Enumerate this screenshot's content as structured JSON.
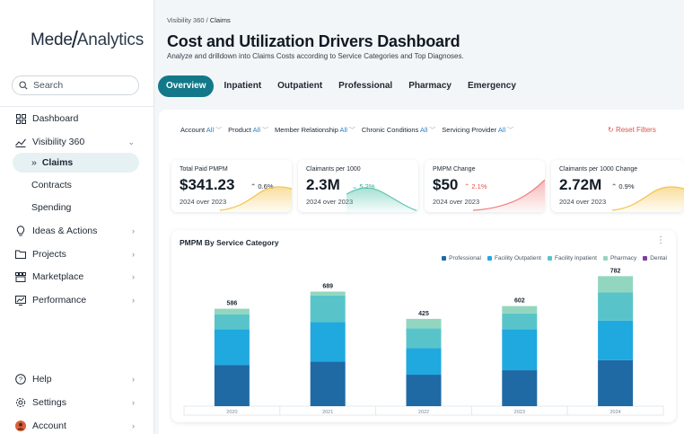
{
  "sidebar": {
    "logo_left": "Mede",
    "logo_slash": "/",
    "logo_right": "Analytics",
    "search_placeholder": "Search",
    "items": [
      {
        "label": "Dashboard",
        "icon": "grid-icon"
      },
      {
        "label": "Visibility 360",
        "icon": "trend-icon"
      },
      {
        "label": "Claims",
        "icon": "double-chevron-icon"
      },
      {
        "label": "Contracts"
      },
      {
        "label": "Spending"
      },
      {
        "label": "Ideas & Actions",
        "icon": "lightbulb-icon"
      },
      {
        "label": "Projects",
        "icon": "folder-icon"
      },
      {
        "label": "Marketplace",
        "icon": "store-icon"
      },
      {
        "label": "Performance",
        "icon": "chart-icon"
      }
    ],
    "bottom": [
      {
        "label": "Help",
        "icon": "help-icon"
      },
      {
        "label": "Settings",
        "icon": "gear-icon"
      },
      {
        "label": "Account",
        "icon": "avatar-icon"
      }
    ]
  },
  "header": {
    "breadcrumb_section": "Visibility 360",
    "breadcrumb_sep": " / ",
    "breadcrumb_page": "Claims",
    "title": "Cost and Utilization Drivers Dashboard",
    "subtitle": "Analyze and drilldown into Claims Costs according to Service Categories and Top Diagnoses."
  },
  "tabs": [
    "Overview",
    "Inpatient",
    "Outpatient",
    "Professional",
    "Pharmacy",
    "Emergency"
  ],
  "filters": [
    {
      "label": "Account",
      "value": "All"
    },
    {
      "label": "Product",
      "value": "All"
    },
    {
      "label": "Member Relationship",
      "value": "All"
    },
    {
      "label": "Chronic Conditions",
      "value": "All"
    },
    {
      "label": "Servicing Provider",
      "value": "All"
    }
  ],
  "reset_label": "Reset Filters",
  "kpis": [
    {
      "label": "Total Paid PMPM",
      "value": "$341.23",
      "delta": "0.6%",
      "direction": "up",
      "delta_color": "#1d2733",
      "sub": "2024 over 2023",
      "spark_color": "#f3c24a"
    },
    {
      "label": "Claimants per 1000",
      "value": "2.3M",
      "delta": "5.2%",
      "direction": "down",
      "delta_color": "#3aa58f",
      "sub": "2024 over 2023",
      "spark_color": "#5cc6b1"
    },
    {
      "label": "PMPM Change",
      "value": "$50",
      "delta": "2.1%",
      "direction": "up",
      "delta_color": "#e0524a",
      "sub": "2024 over 2023",
      "spark_color": "#ef7c7c"
    },
    {
      "label": "Claimants per 1000 Change",
      "value": "2.72M",
      "delta": "0.9%",
      "direction": "up",
      "delta_color": "#1d2733",
      "sub": "2024 over 2023",
      "spark_color": "#f3c24a"
    }
  ],
  "chart_title": "PMPM By Service Category",
  "chart_data": {
    "type": "bar",
    "stacked": true,
    "categories": [
      "2020",
      "2021",
      "2022",
      "2023",
      "2024"
    ],
    "totals": [
      586,
      689,
      425,
      602,
      782
    ],
    "series": [
      {
        "name": "Professional",
        "color": "#1f6aa5",
        "values": [
          248,
          268,
          189,
          216,
          277
        ]
      },
      {
        "name": "Facility Outpatient",
        "color": "#1fa9df",
        "values": [
          215,
          238,
          160,
          247,
          238
        ]
      },
      {
        "name": "Facility Inpatient",
        "color": "#58c4c9",
        "values": [
          90,
          160,
          120,
          95,
          169
        ]
      },
      {
        "name": "Pharmacy",
        "color": "#93d6bf",
        "values": [
          33,
          23,
          56,
          44,
          98
        ]
      },
      {
        "name": "Dental",
        "color": "#7b3fa0",
        "values": [
          0,
          0,
          0,
          0,
          0
        ]
      }
    ],
    "ylim": [
      0,
      800
    ],
    "legend_position": "top-right",
    "grid": false
  }
}
